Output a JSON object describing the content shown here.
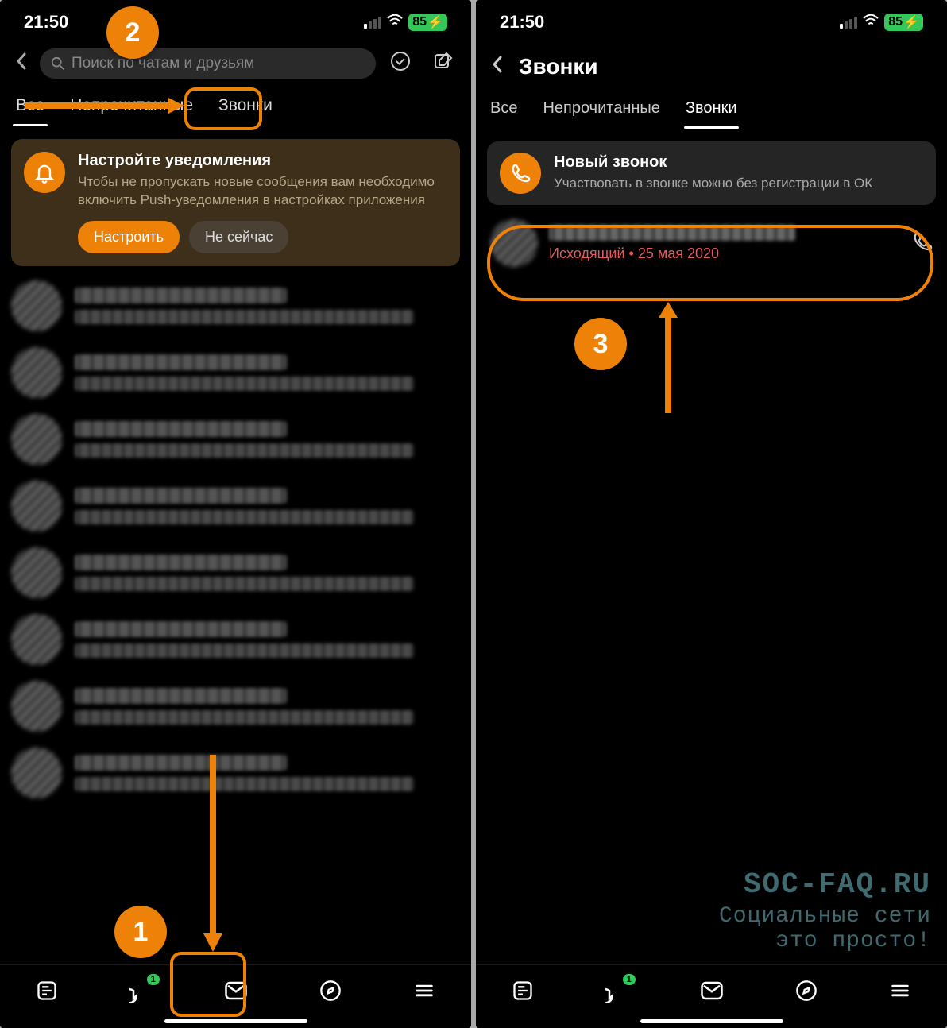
{
  "status": {
    "time": "21:50",
    "battery": "85"
  },
  "left": {
    "search": {
      "placeholder": "Поиск по чатам и друзьям"
    },
    "tabs": {
      "all": "Все",
      "unread": "Непрочитанные",
      "calls": "Звонки"
    },
    "notif": {
      "title": "Настройте уведомления",
      "body": "Чтобы не пропускать новые сообщения вам необходимо включить Push-уведомления в настройках приложения",
      "primary": "Настроить",
      "secondary": "Не сейчас"
    },
    "nav_badge": "1"
  },
  "right": {
    "title": "Звонки",
    "tabs": {
      "all": "Все",
      "unread": "Непрочитанные",
      "calls": "Звонки"
    },
    "new_call": {
      "title": "Новый звонок",
      "body": "Участвовать в звонке можно без регистрации в ОК"
    },
    "call_entry": {
      "meta": "Исходящий • 25 мая 2020"
    }
  },
  "annotations": {
    "step1": "1",
    "step2": "2",
    "step3": "3"
  },
  "watermark": {
    "line1": "SOC-FAQ.RU",
    "line2": "Социальные сети",
    "line3": "это просто!"
  },
  "chat_items_count": 8
}
